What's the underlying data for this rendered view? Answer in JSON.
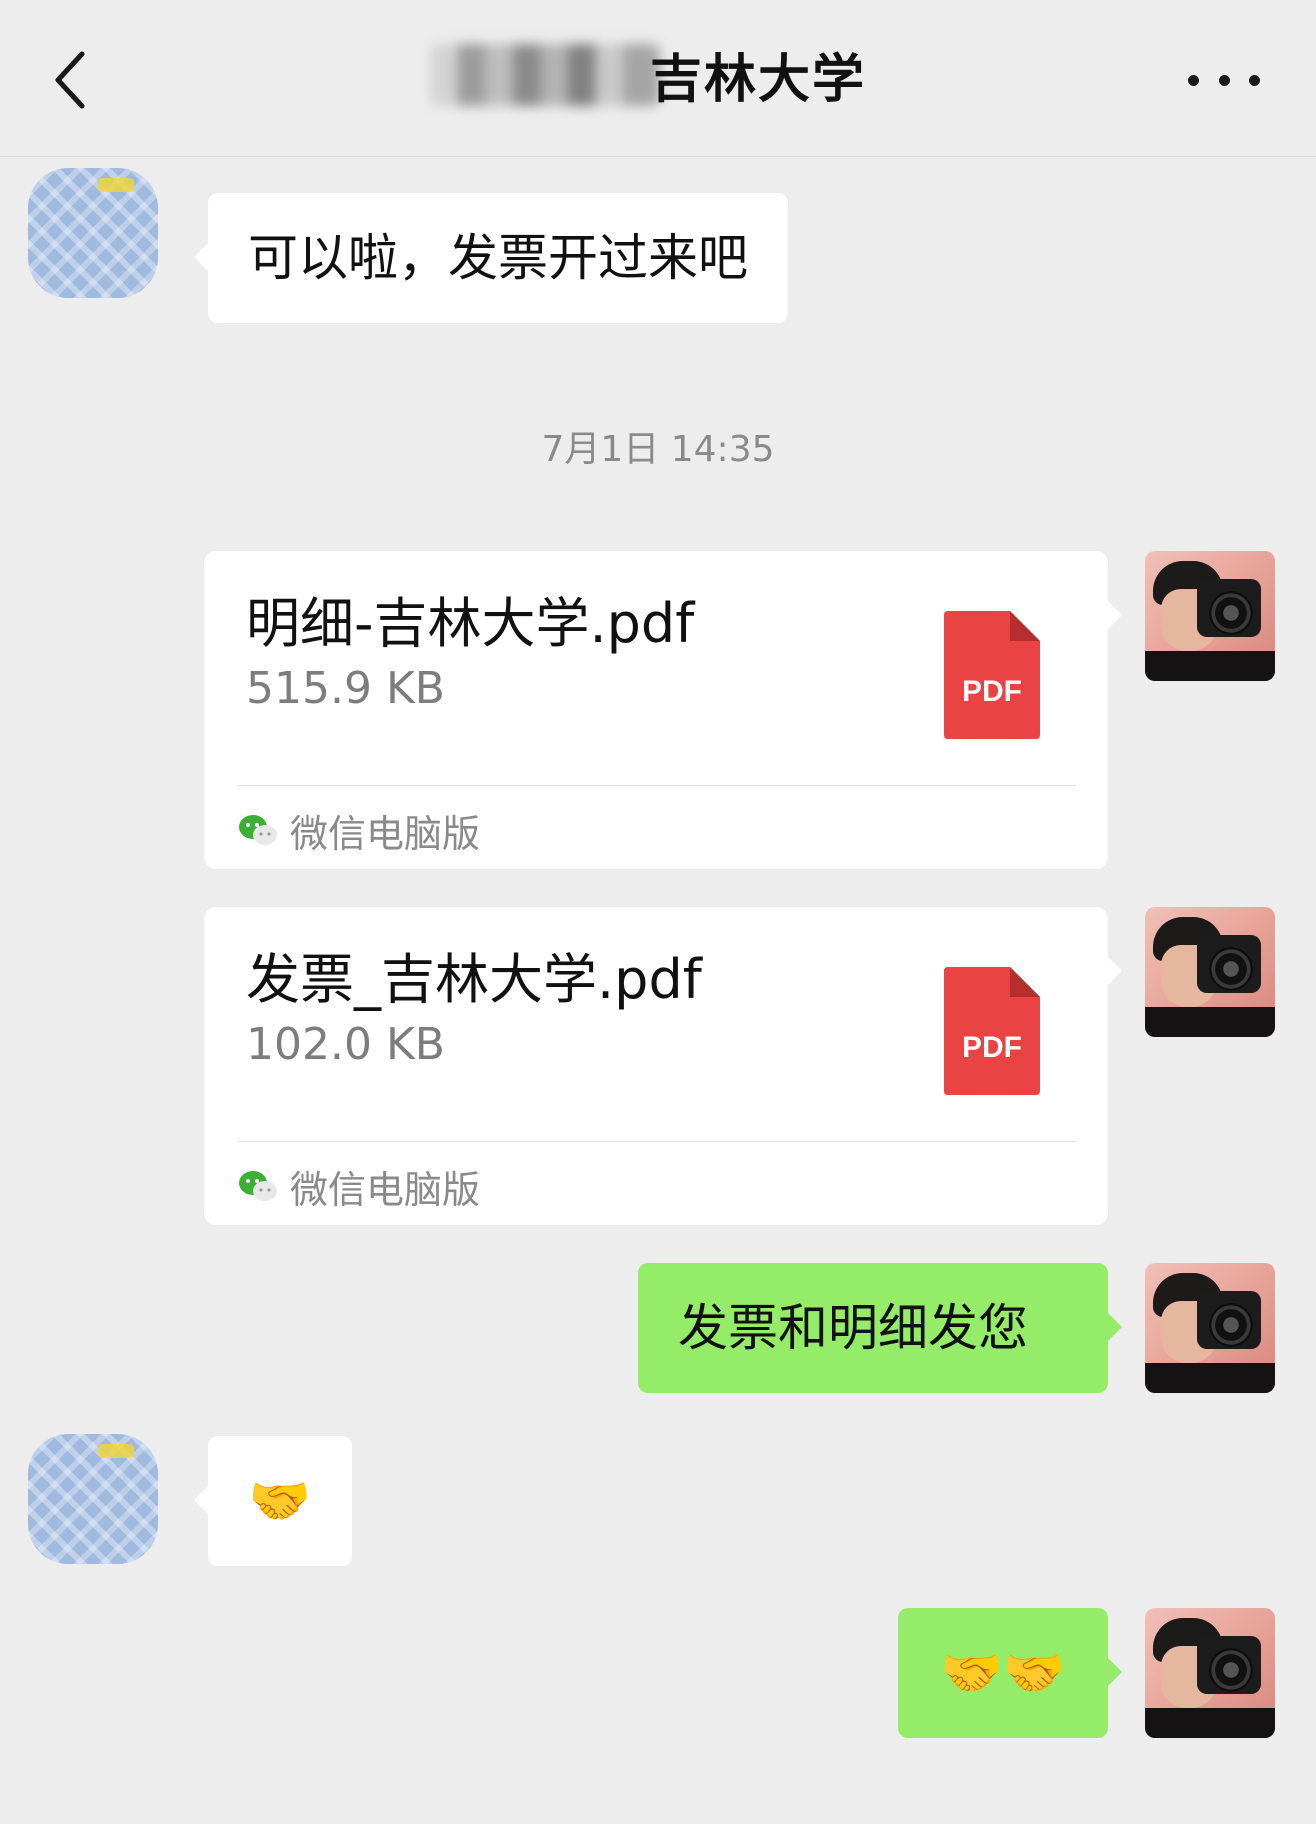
{
  "header": {
    "title": "吉林大学",
    "back_icon": "chevron-left-icon",
    "more_icon": "more-dots-icon"
  },
  "messages": [
    {
      "sender": "other",
      "type": "text",
      "text": "可以啦，发票开过来吧"
    },
    {
      "type": "timestamp",
      "text": "7月1日 14:35"
    },
    {
      "sender": "me",
      "type": "file",
      "name": "明细-吉林大学.pdf",
      "size": "515.9 KB",
      "badge": "PDF",
      "source": "微信电脑版"
    },
    {
      "sender": "me",
      "type": "file",
      "name": "发票_吉林大学.pdf",
      "size": "102.0 KB",
      "badge": "PDF",
      "source": "微信电脑版"
    },
    {
      "sender": "me",
      "type": "text",
      "text": "发票和明细发您"
    },
    {
      "sender": "other",
      "type": "emoji",
      "text": "🤝"
    },
    {
      "sender": "me",
      "type": "emoji",
      "text": "🤝🤝"
    }
  ],
  "colors": {
    "background": "#ededed",
    "my_bubble": "#95ec69",
    "other_bubble": "#ffffff",
    "pdf_red": "#e94343",
    "wechat_green": "#3cb034"
  }
}
